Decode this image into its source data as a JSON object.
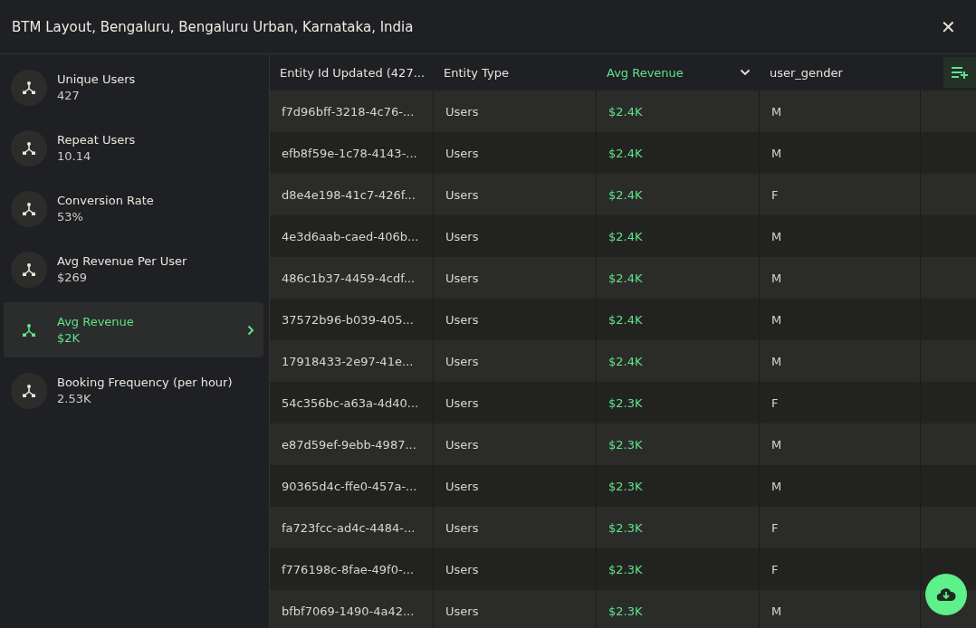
{
  "window": {
    "title": "BTM Layout, Bengaluru, Bengaluru Urban, Karnataka, India",
    "close": "✕"
  },
  "metrics": [
    {
      "name": "Unique Users",
      "value": "427",
      "selected": false
    },
    {
      "name": "Repeat Users",
      "value": "10.14",
      "selected": false
    },
    {
      "name": "Conversion Rate",
      "value": "53%",
      "selected": false
    },
    {
      "name": "Avg Revenue Per User",
      "value": "$269",
      "selected": false
    },
    {
      "name": "Avg Revenue",
      "value": "$2K",
      "selected": true
    },
    {
      "name": "Booking Frequency (per hour)",
      "value": "2.53K",
      "selected": false
    }
  ],
  "table": {
    "columns": [
      {
        "label": "Entity Id Updated (427...",
        "selected": false
      },
      {
        "label": "Entity Type",
        "selected": false
      },
      {
        "label": "Avg Revenue",
        "selected": true
      },
      {
        "label": "user_gender",
        "selected": false
      }
    ],
    "rows": [
      [
        "f7d96bff-3218-4c76-...",
        "Users",
        "$2.4K",
        "M"
      ],
      [
        "efb8f59e-1c78-4143-...",
        "Users",
        "$2.4K",
        "M"
      ],
      [
        "d8e4e198-41c7-426f...",
        "Users",
        "$2.4K",
        "F"
      ],
      [
        "4e3d6aab-caed-406b...",
        "Users",
        "$2.4K",
        "M"
      ],
      [
        "486c1b37-4459-4cdf...",
        "Users",
        "$2.4K",
        "M"
      ],
      [
        "37572b96-b039-405...",
        "Users",
        "$2.4K",
        "M"
      ],
      [
        "17918433-2e97-41e...",
        "Users",
        "$2.4K",
        "M"
      ],
      [
        "54c356bc-a63a-4d40...",
        "Users",
        "$2.3K",
        "F"
      ],
      [
        "e87d59ef-9ebb-4987...",
        "Users",
        "$2.3K",
        "M"
      ],
      [
        "90365d4c-ffe0-457a-...",
        "Users",
        "$2.3K",
        "M"
      ],
      [
        "fa723fcc-ad4c-4484-...",
        "Users",
        "$2.3K",
        "F"
      ],
      [
        "f776198c-8fae-49f0-...",
        "Users",
        "$2.3K",
        "F"
      ],
      [
        "bfbf7069-1490-4a42...",
        "Users",
        "$2.3K",
        "M"
      ]
    ]
  }
}
